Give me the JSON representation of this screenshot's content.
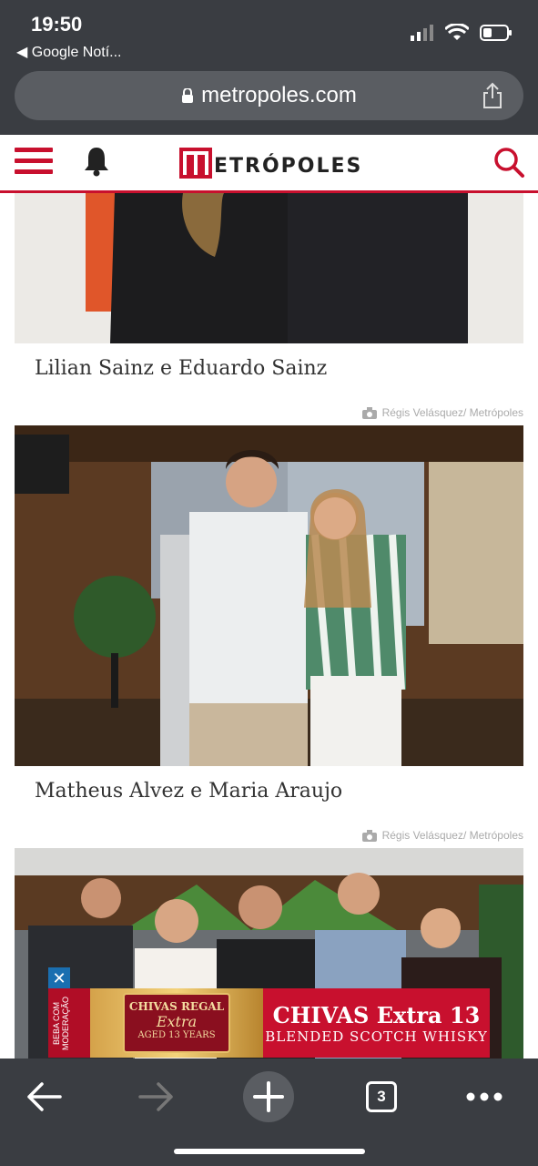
{
  "status_bar": {
    "time": "19:50",
    "back_app": "◀ Google Notí..."
  },
  "browser": {
    "url": "metropoles.com",
    "tab_count": "3"
  },
  "site": {
    "logo_text": "ETRÓPOLES"
  },
  "gallery": [
    {
      "caption": "Lilian Sainz e Eduardo Sainz",
      "credit": "Régis Velásquez/ Metrópoles"
    },
    {
      "caption": "Matheus Alvez e Maria Araujo",
      "credit": "Régis Velásquez/ Metrópoles"
    }
  ],
  "ad": {
    "close": "✕",
    "side_text": "BEBA COM MODERAÇÃO",
    "label_line1": "CHIVAS REGAL",
    "label_line2": "Extra",
    "label_line3": "AGED 13 YEARS",
    "title": "CHIVAS Extra 13",
    "subtitle": "BLENDED SCOTCH WHISKY"
  },
  "colors": {
    "brand": "#c8102e",
    "chrome": "#3a3d42"
  }
}
